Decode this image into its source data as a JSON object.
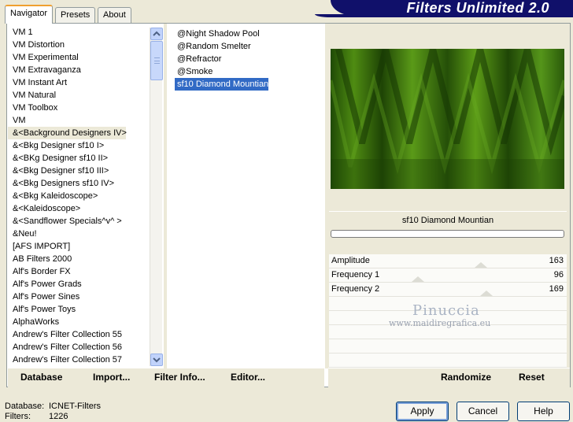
{
  "banner": {
    "title": "Filters Unlimited 2.0"
  },
  "tabs": [
    {
      "label": "Navigator"
    },
    {
      "label": "Presets"
    },
    {
      "label": "About"
    }
  ],
  "categories": [
    "VM 1",
    "VM Distortion",
    "VM Experimental",
    "VM Extravaganza",
    "VM Instant Art",
    "VM Natural",
    "VM Toolbox",
    "VM",
    "&<Background Designers IV>",
    "&<Bkg Designer sf10 I>",
    "&<BKg Designer sf10 II>",
    "&<Bkg Designer sf10 III>",
    "&<Bkg Designers sf10 IV>",
    "&<Bkg Kaleidoscope>",
    "&<Kaleidoscope>",
    "&<Sandflower Specials^v^ >",
    "&Neu!",
    "[AFS IMPORT]",
    "AB Filters 2000",
    "Alf's Border FX",
    "Alf's Power Grads",
    "Alf's Power Sines",
    "Alf's Power Toys",
    "AlphaWorks",
    "Andrew's Filter Collection 55",
    "Andrew's Filter Collection 56",
    "Andrew's Filter Collection 57"
  ],
  "selected_category_index": 8,
  "filters": [
    "@Night Shadow Pool",
    "@Random Smelter",
    "@Refractor",
    "@Smoke",
    "sf10 Diamond Mountian"
  ],
  "selected_filter_index": 4,
  "preview": {
    "filter_name": "sf10 Diamond Mountian"
  },
  "params": [
    {
      "label": "Amplitude",
      "value": "163",
      "level": 163
    },
    {
      "label": "Frequency 1",
      "value": "96",
      "level": 96
    },
    {
      "label": "Frequency 2",
      "value": "169",
      "level": 169
    }
  ],
  "watermark": {
    "title": "Pinuccia",
    "url": "www.maidiregrafica.eu"
  },
  "toolbar": {
    "database": "Database",
    "import": "Import...",
    "filter_info": "Filter Info...",
    "editor": "Editor...",
    "randomize": "Randomize",
    "reset": "Reset"
  },
  "status": {
    "database_label": "Database:",
    "database_value": "ICNET-Filters",
    "filters_label": "Filters:",
    "filters_value": "1226"
  },
  "buttons": {
    "apply": "Apply",
    "cancel": "Cancel",
    "help": "Help"
  },
  "colors": {
    "banner": "#10106a",
    "selection": "#316ac5",
    "preview_green": "#2e5e0a"
  }
}
